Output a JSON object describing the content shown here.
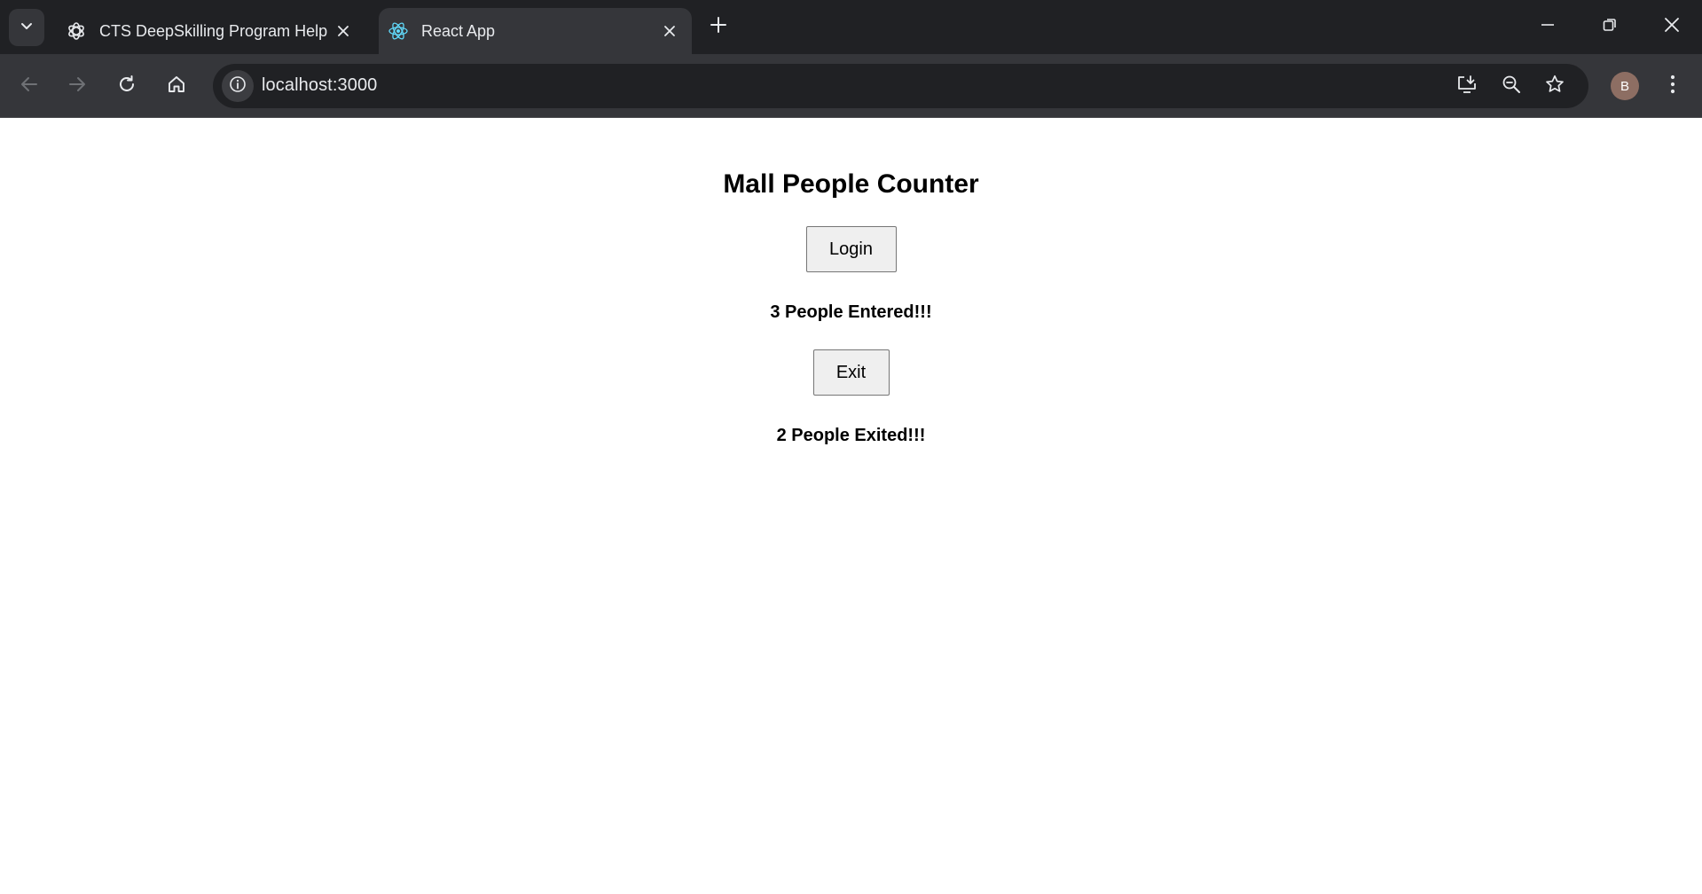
{
  "browser": {
    "tabs": [
      {
        "title": "CTS DeepSkilling Program Help",
        "icon": "openai-icon",
        "active": false
      },
      {
        "title": "React App",
        "icon": "react-icon",
        "active": true
      }
    ],
    "address_bar": {
      "url": "localhost:3000"
    },
    "profile_initial": "B",
    "colors": {
      "tabstrip_bg": "#202124",
      "toolbar_bg": "#35363a",
      "omnibox_bg": "#202124",
      "text": "#e8eaed",
      "avatar_bg": "#8d6e63",
      "react_blue": "#61dafb"
    }
  },
  "app": {
    "title": "Mall People Counter",
    "login_button": "Login",
    "entered_message": "3 People Entered!!!",
    "exit_button": "Exit",
    "exited_message": "2 People Exited!!!"
  }
}
